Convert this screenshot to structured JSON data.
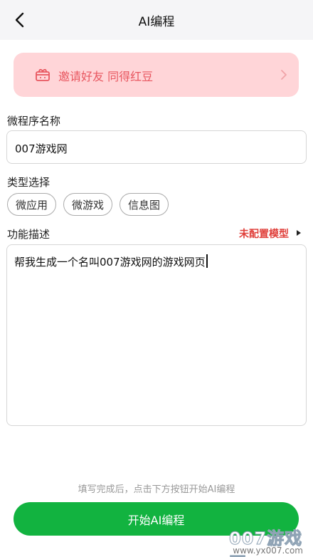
{
  "header": {
    "title": "AI编程"
  },
  "invite": {
    "text": "邀请好友 同得红豆"
  },
  "name_section": {
    "label": "微程序名称",
    "value": "007游戏网"
  },
  "type_section": {
    "label": "类型选择",
    "options": [
      "微应用",
      "微游戏",
      "信息图"
    ]
  },
  "desc_section": {
    "label": "功能描述",
    "model_link": "未配置模型",
    "value": "帮我生成一个名叫007游戏网的游戏网页"
  },
  "footer": {
    "hint": "填写完成后，点击下方按钮开始AI编程",
    "button_label": "开始AI编程"
  },
  "watermark": {
    "brand": "007游戏网",
    "url": "www.yx007.com"
  },
  "colors": {
    "accent_green": "#12b340",
    "invite_bg": "#ffd5d8",
    "invite_text": "#e8565f",
    "model_red": "#e0403b"
  }
}
